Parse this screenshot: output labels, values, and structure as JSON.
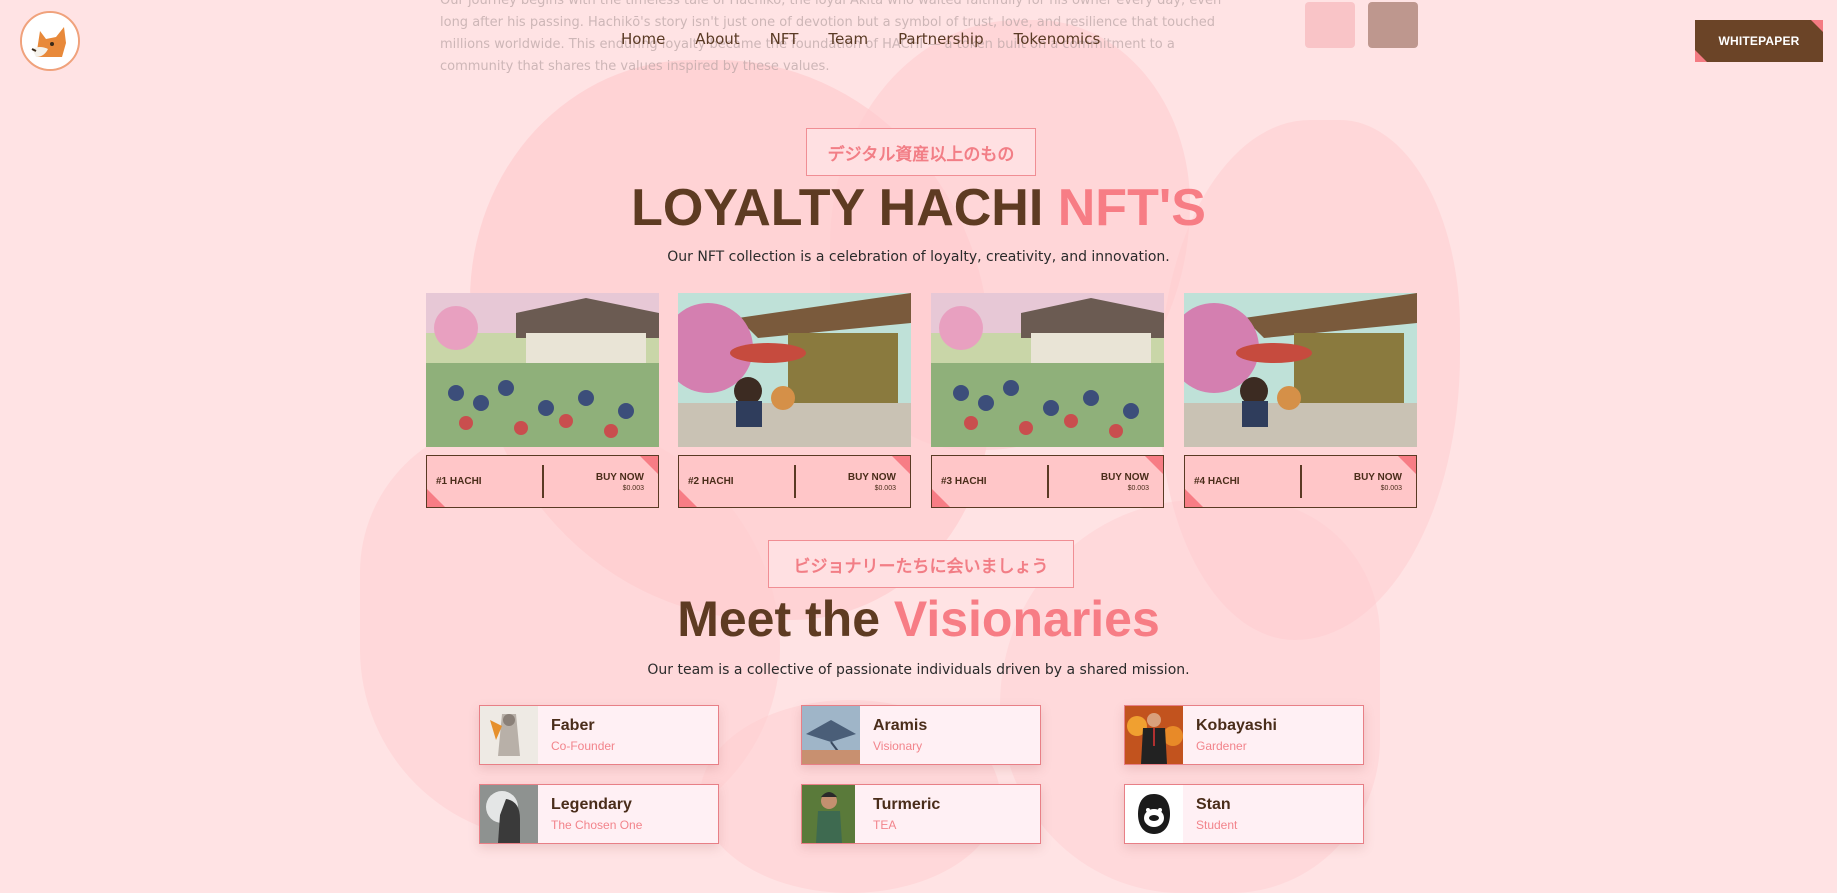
{
  "background_text": "Our journey begins with the timeless tale of Hachiko, the loyal Akita who waited faithfully for his owner every day, even long after his passing. Hachikō's story isn't just one of devotion but a symbol of trust, love, and resilience that touched millions worldwide. This enduring loyalty became the foundation of HACHI — a token built on a commitment to a community that shares the values inspired by these values.",
  "nav": {
    "items": [
      "Home",
      "About",
      "NFT",
      "Team",
      "Partnership",
      "Tokenomics"
    ],
    "whitepaper_label": "WHITEPAPER"
  },
  "nft_section": {
    "jp_tag": "デジタル資産以上のもの",
    "title_main": "LOYALTY HACHI ",
    "title_accent": "NFT'S",
    "subtitle": "Our NFT collection is a celebration of loyalty, creativity, and innovation.",
    "cards": [
      {
        "name": "#1 HACHI",
        "buy": "BUY NOW",
        "price": "$0.003",
        "image": "festival-crowd"
      },
      {
        "name": "#2 HACHI",
        "buy": "BUY NOW",
        "price": "$0.003",
        "image": "boy-with-umbrella"
      },
      {
        "name": "#3 HACHI",
        "buy": "BUY NOW",
        "price": "$0.003",
        "image": "festival-crowd"
      },
      {
        "name": "#4 HACHI",
        "buy": "BUY NOW",
        "price": "$0.003",
        "image": "boy-with-umbrella"
      }
    ]
  },
  "team_section": {
    "jp_tag": "ビジョナリーたちに会いましょう",
    "title_main": "Meet the ",
    "title_accent": "Visionaries",
    "subtitle": "Our team is a collective of passionate individuals driven by a shared mission.",
    "members": [
      {
        "name": "Faber",
        "role": "Co-Founder",
        "avatar": "armored-warrior"
      },
      {
        "name": "Aramis",
        "role": "Visionary",
        "avatar": "stingray-sea"
      },
      {
        "name": "Kobayashi",
        "role": "Gardener",
        "avatar": "man-in-suit-fire"
      },
      {
        "name": "Legendary",
        "role": "The Chosen One",
        "avatar": "hooded-figure"
      },
      {
        "name": "Turmeric",
        "role": "TEA",
        "avatar": "woman-in-green"
      },
      {
        "name": "Stan",
        "role": "Student",
        "avatar": "gorilla-face"
      }
    ]
  },
  "colors": {
    "background": "#ffe3e4",
    "brown": "#5e3b22",
    "accent_pink": "#f77d85",
    "button_brown": "#6b4427"
  }
}
